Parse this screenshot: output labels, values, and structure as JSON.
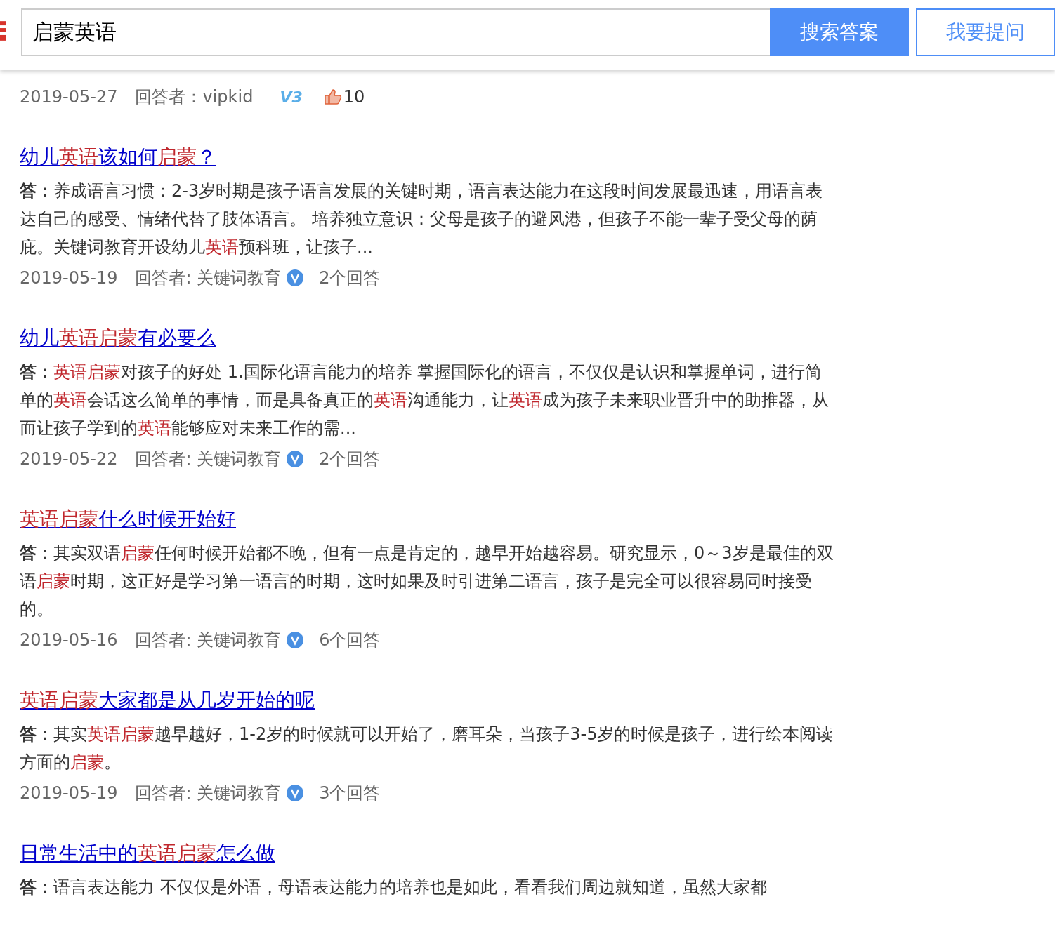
{
  "search": {
    "value": "启蒙英语",
    "search_button": "搜索答案",
    "ask_button": "我要提问"
  },
  "partial_item": {
    "date": "2019-05-27",
    "answerer": "回答者：vipkid",
    "badge": "V3",
    "likes": "10"
  },
  "results": [
    {
      "title": [
        {
          "text": "幼儿",
          "highlight": false
        },
        {
          "text": "英语",
          "highlight": true
        },
        {
          "text": "该如何",
          "highlight": false
        },
        {
          "text": "启蒙",
          "highlight": true
        },
        {
          "text": "？",
          "highlight": false
        }
      ],
      "answer_label": "答：",
      "answer": [
        {
          "text": "养成语言习惯：2-3岁时期是孩子语言发展的关键时期，语言表达能力在这段时间发展最迅速，用语言表达自己的感受、情绪代替了肢体语言。 培养独立意识：父母是孩子的避风港，但孩子不能一辈子受父母的荫庇。关键词教育开设幼儿",
          "highlight": false
        },
        {
          "text": "英语",
          "highlight": true
        },
        {
          "text": "预科班，让孩子...",
          "highlight": false
        }
      ],
      "date": "2019-05-19",
      "answerer": "回答者: 关键词教育",
      "verified": true,
      "answer_count": "2个回答"
    },
    {
      "title": [
        {
          "text": "幼儿",
          "highlight": false
        },
        {
          "text": "英语启蒙",
          "highlight": true
        },
        {
          "text": "有必要么",
          "highlight": false
        }
      ],
      "answer_label": "答：",
      "answer": [
        {
          "text": "英语启蒙",
          "highlight": true
        },
        {
          "text": "对孩子的好处 1.国际化语言能力的培养 掌握国际化的语言，不仅仅是认识和掌握单词，进行简单的",
          "highlight": false
        },
        {
          "text": "英语",
          "highlight": true
        },
        {
          "text": "会话这么简单的事情，而是具备真正的",
          "highlight": false
        },
        {
          "text": "英语",
          "highlight": true
        },
        {
          "text": "沟通能力，让",
          "highlight": false
        },
        {
          "text": "英语",
          "highlight": true
        },
        {
          "text": "成为孩子未来职业晋升中的助推器，从而让孩子学到的",
          "highlight": false
        },
        {
          "text": "英语",
          "highlight": true
        },
        {
          "text": "能够应对未来工作的需...",
          "highlight": false
        }
      ],
      "date": "2019-05-22",
      "answerer": "回答者: 关键词教育",
      "verified": true,
      "answer_count": "2个回答"
    },
    {
      "title": [
        {
          "text": "英语启蒙",
          "highlight": true
        },
        {
          "text": "什么时候开始好",
          "highlight": false
        }
      ],
      "answer_label": "答：",
      "answer": [
        {
          "text": "其实双语",
          "highlight": false
        },
        {
          "text": "启蒙",
          "highlight": true
        },
        {
          "text": "任何时候开始都不晚，但有一点是肯定的，越早开始越容易。研究显示，0～3岁是最佳的双语",
          "highlight": false
        },
        {
          "text": "启蒙",
          "highlight": true
        },
        {
          "text": "时期，这正好是学习第一语言的时期，这时如果及时引进第二语言，孩子是完全可以很容易同时接受的。",
          "highlight": false
        }
      ],
      "date": "2019-05-16",
      "answerer": "回答者: 关键词教育",
      "verified": true,
      "answer_count": "6个回答"
    },
    {
      "title": [
        {
          "text": "英语启蒙",
          "highlight": true
        },
        {
          "text": "大家都是从几岁开始的呢",
          "highlight": false
        }
      ],
      "answer_label": "答：",
      "answer": [
        {
          "text": "其实",
          "highlight": false
        },
        {
          "text": "英语启蒙",
          "highlight": true
        },
        {
          "text": "越早越好，1-2岁的时候就可以开始了，磨耳朵，当孩子3-5岁的时候是孩子，进行绘本阅读方面的",
          "highlight": false
        },
        {
          "text": "启蒙",
          "highlight": true
        },
        {
          "text": "。",
          "highlight": false
        }
      ],
      "date": "2019-05-19",
      "answerer": "回答者: 关键词教育",
      "verified": true,
      "answer_count": "3个回答"
    },
    {
      "title": [
        {
          "text": "日常生活中的",
          "highlight": false
        },
        {
          "text": "英语启蒙",
          "highlight": true
        },
        {
          "text": "怎么做",
          "highlight": false
        }
      ],
      "answer_label": "答：",
      "answer": [
        {
          "text": "语言表达能力 不仅仅是外语，母语表达能力的培养也是如此，看看我们周边就知道，虽然大家都",
          "highlight": false
        }
      ]
    }
  ]
}
